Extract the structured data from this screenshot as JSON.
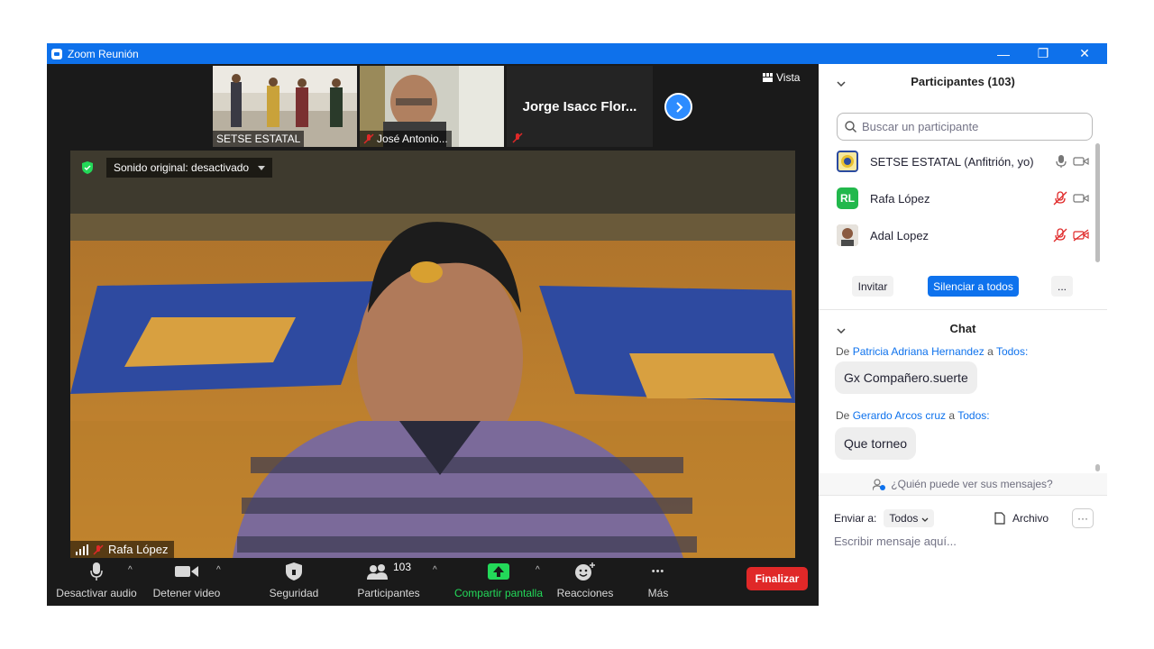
{
  "window": {
    "title": "Zoom Reunión",
    "minimize_glyph": "—",
    "restore_glyph": "❐",
    "close_glyph": "✕"
  },
  "thumbnails": [
    {
      "name": "SETSE ESTATAL",
      "muted": false
    },
    {
      "name": "José Antonio...",
      "muted": true
    },
    {
      "name": "Jorge Isacc Flor...",
      "muted": true
    }
  ],
  "view": {
    "label": "Vista"
  },
  "main_video": {
    "sound_label": "Sonido original: desactivado",
    "speaker_name": "Rafa López"
  },
  "toolbar": {
    "audio": "Desactivar audio",
    "video": "Detener video",
    "security": "Seguridad",
    "participants": "Participantes",
    "participants_count": "103",
    "share": "Compartir pantalla",
    "reactions": "Reacciones",
    "more": "Más",
    "end": "Finalizar",
    "more_glyph": "•••"
  },
  "participants_panel": {
    "title": "Participantes (103)",
    "search_placeholder": "Buscar un participante",
    "participants": [
      {
        "name": "SETSE ESTATAL (Anfitrión, yo)",
        "initials": "",
        "muted": false,
        "video_off": false
      },
      {
        "name": "Rafa López",
        "initials": "RL",
        "muted": true,
        "video_off": false
      },
      {
        "name": "Adal Lopez",
        "initials": "",
        "muted": true,
        "video_off": true
      }
    ],
    "invite": "Invitar",
    "mute_all": "Silenciar a todos",
    "more": "..."
  },
  "chat": {
    "title": "Chat",
    "messages": [
      {
        "prefix": "De",
        "from": "Patricia Adriana Hernandez",
        "to_word": "a",
        "to": "Todos:",
        "text": "Gx Compañero.suerte"
      },
      {
        "prefix": "De",
        "from": "Gerardo Arcos cruz",
        "to_word": "a",
        "to": "Todos:",
        "text": "Que torneo"
      }
    ],
    "who_can_see": "¿Quién puede ver sus mensajes?",
    "send_to_label": "Enviar a:",
    "send_to_value": "Todos",
    "file": "Archivo",
    "more": "···",
    "input_placeholder": "Escribir mensaje aquí..."
  },
  "colors": {
    "titlebar": "#0e71eb",
    "end_button": "#e02828",
    "share_green": "#23d959",
    "link_blue": "#0e72ed",
    "mute_all": "#0e72ed"
  }
}
